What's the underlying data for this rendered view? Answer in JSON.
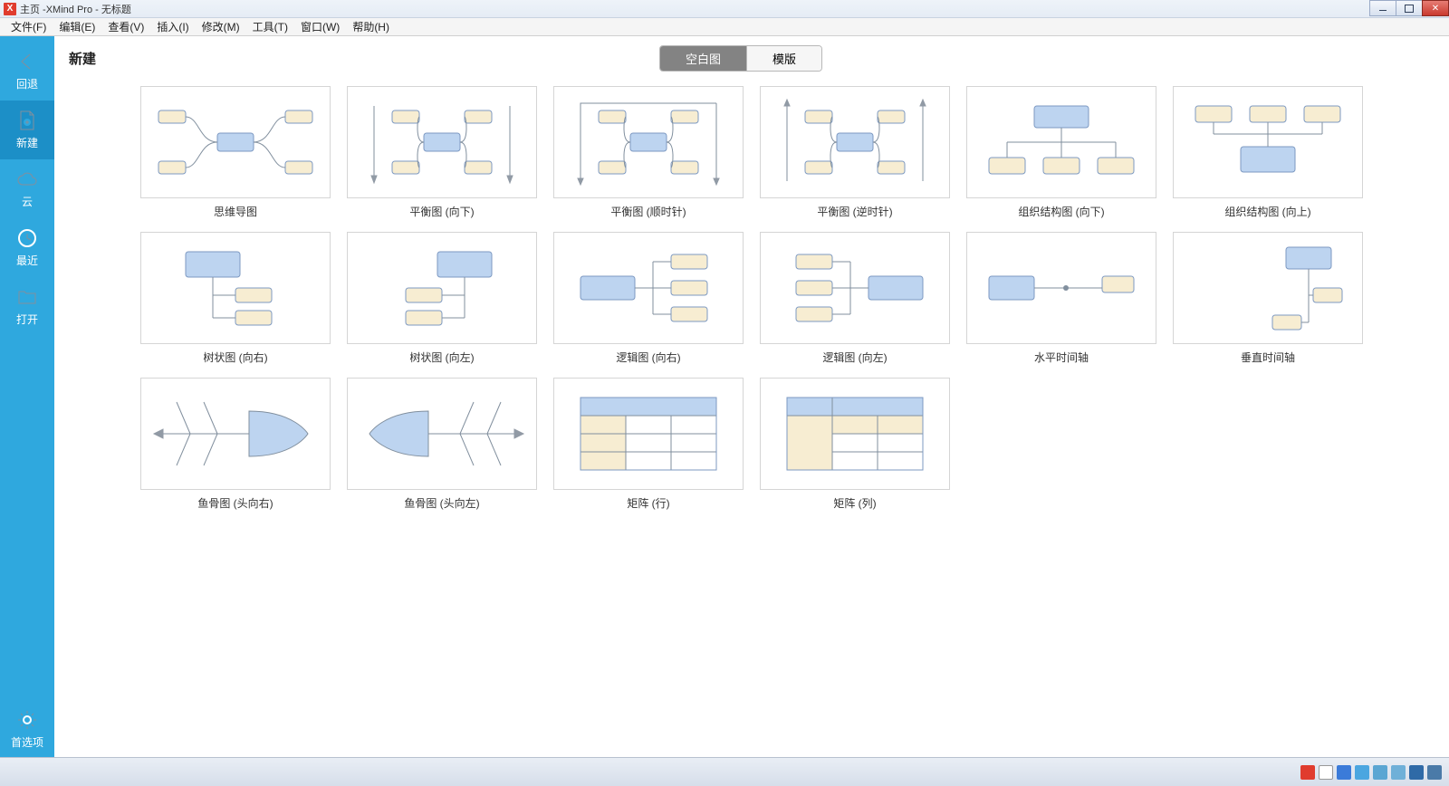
{
  "window": {
    "title": "主页 -XMind Pro - 无标题"
  },
  "menu": {
    "file": "文件(F)",
    "edit": "编辑(E)",
    "view": "查看(V)",
    "insert": "插入(I)",
    "modify": "修改(M)",
    "tools": "工具(T)",
    "window": "窗口(W)",
    "help": "帮助(H)"
  },
  "sidebar": {
    "back": "回退",
    "new": "新建",
    "cloud": "云",
    "recent": "最近",
    "open": "打开",
    "prefs": "首选项"
  },
  "page": {
    "title": "新建",
    "tab_blank": "空白图",
    "tab_template": "模版"
  },
  "templates": [
    {
      "id": "mindmap",
      "label": "思维导图"
    },
    {
      "id": "balanced-down",
      "label": "平衡图 (向下)"
    },
    {
      "id": "balanced-cw",
      "label": "平衡图 (顺时针)"
    },
    {
      "id": "balanced-ccw",
      "label": "平衡图 (逆时针)"
    },
    {
      "id": "org-down",
      "label": "组织结构图 (向下)"
    },
    {
      "id": "org-up",
      "label": "组织结构图 (向上)"
    },
    {
      "id": "tree-right",
      "label": "树状图 (向右)"
    },
    {
      "id": "tree-left",
      "label": "树状图 (向左)"
    },
    {
      "id": "logic-right",
      "label": "逻辑图 (向右)"
    },
    {
      "id": "logic-left",
      "label": "逻辑图 (向左)"
    },
    {
      "id": "timeline-h",
      "label": "水平时间轴"
    },
    {
      "id": "timeline-v",
      "label": "垂直时间轴"
    },
    {
      "id": "fishbone-right",
      "label": "鱼骨图 (头向右)"
    },
    {
      "id": "fishbone-left",
      "label": "鱼骨图 (头向左)"
    },
    {
      "id": "matrix-row",
      "label": "矩阵 (行)"
    },
    {
      "id": "matrix-col",
      "label": "矩阵 (列)"
    }
  ]
}
